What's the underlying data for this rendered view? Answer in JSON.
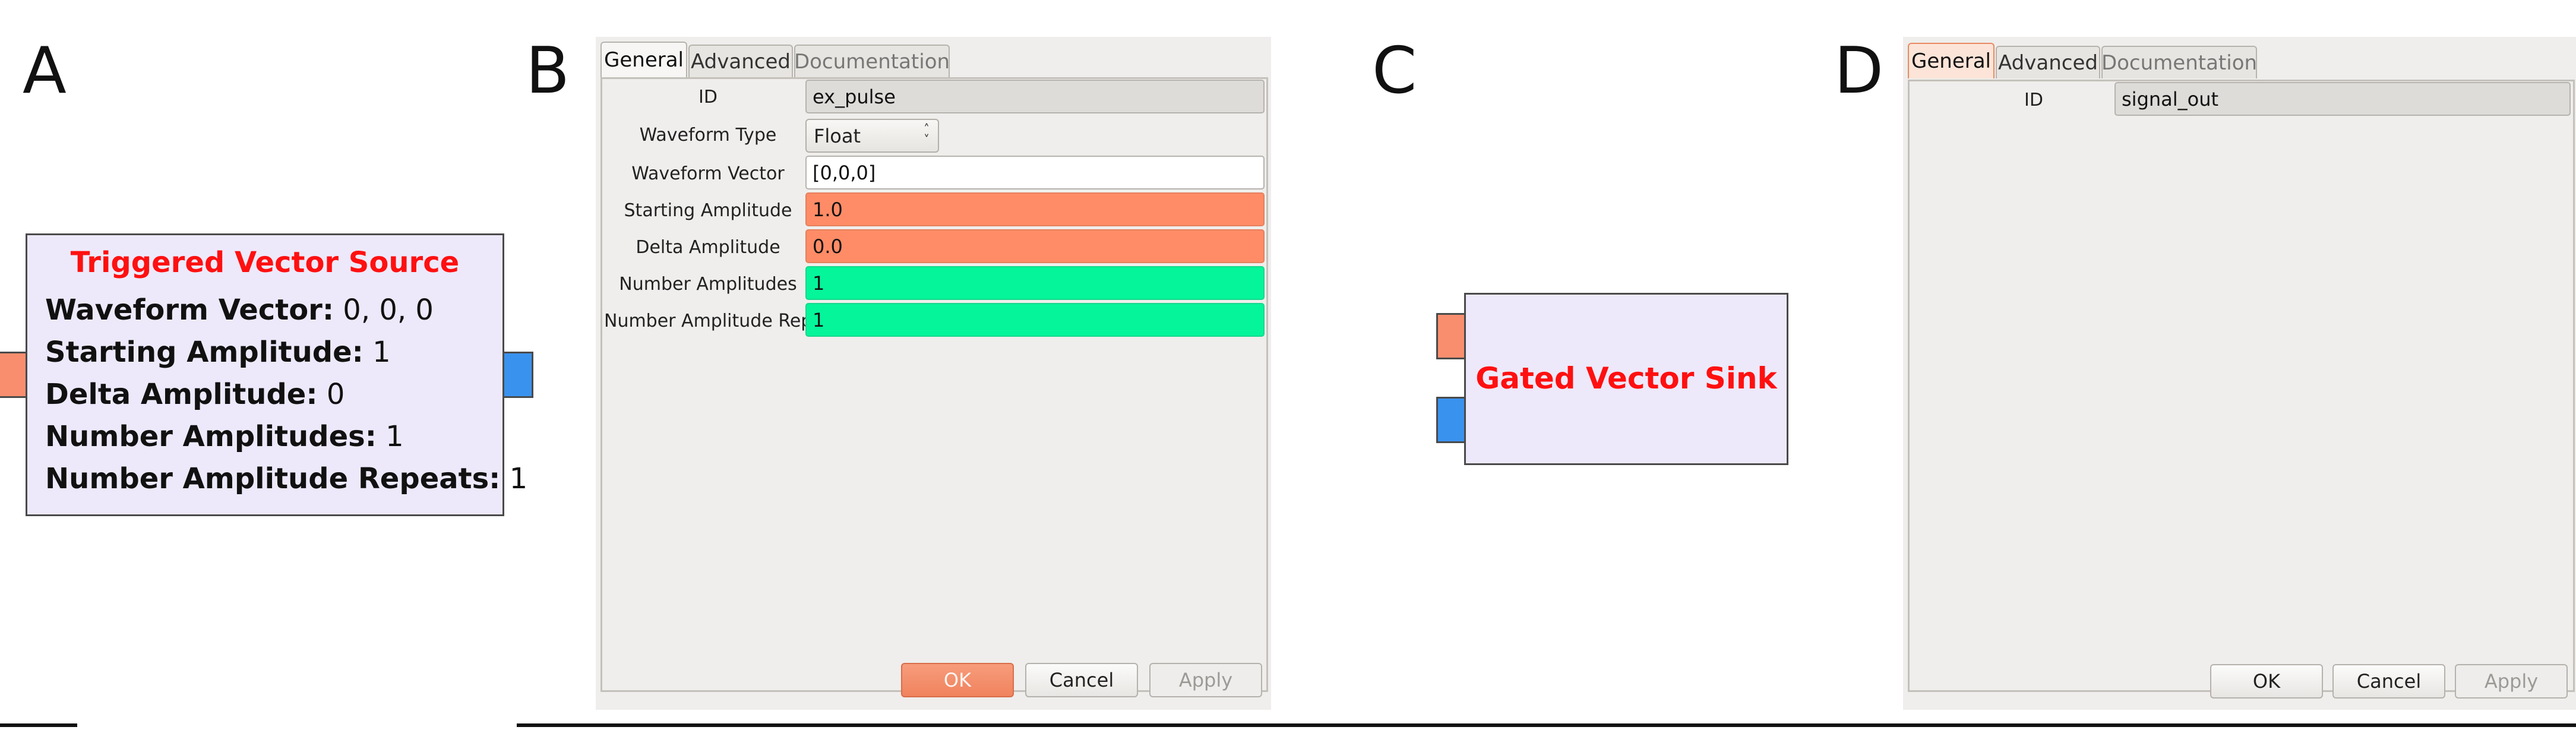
{
  "panels": {
    "a": "A",
    "b": "B",
    "c": "C",
    "d": "D"
  },
  "block_a": {
    "title": "Triggered Vector Source",
    "params": [
      {
        "name": "Waveform Vector:",
        "value": " 0, 0, 0"
      },
      {
        "name": "Starting Amplitude:",
        "value": " 1"
      },
      {
        "name": "Delta Amplitude:",
        "value": " 0"
      },
      {
        "name": "Number Amplitudes:",
        "value": " 1"
      },
      {
        "name": "Number Amplitude Repeats:",
        "value": " 1"
      }
    ]
  },
  "dialog_b": {
    "tabs": [
      "General",
      "Advanced",
      "Documentation"
    ],
    "rows": [
      {
        "label": "ID",
        "value": "ex_pulse"
      },
      {
        "label": "Waveform Type",
        "value": "Float"
      },
      {
        "label": "Waveform Vector",
        "value": "[0,0,0]"
      },
      {
        "label": "Starting Amplitude",
        "value": "1.0"
      },
      {
        "label": "Delta Amplitude",
        "value": "0.0"
      },
      {
        "label": "Number Amplitudes",
        "value": "1"
      },
      {
        "label": "Number Amplitude Repeat",
        "value": "1"
      }
    ],
    "buttons": {
      "ok": "OK",
      "cancel": "Cancel",
      "apply": "Apply"
    }
  },
  "block_c": {
    "title": "Gated Vector Sink"
  },
  "dialog_d": {
    "tabs": [
      "General",
      "Advanced",
      "Documentation"
    ],
    "rows": [
      {
        "label": "ID",
        "value": "signal_out"
      }
    ],
    "buttons": {
      "ok": "OK",
      "cancel": "Cancel",
      "apply": "Apply"
    }
  },
  "colors": {
    "block_fill": "#ede9fb",
    "block_title": "#ff1010",
    "input_port": "#f98e6e",
    "output_port": "#3a92ef",
    "field_float": "#ff8c66",
    "field_int": "#05f59b"
  }
}
